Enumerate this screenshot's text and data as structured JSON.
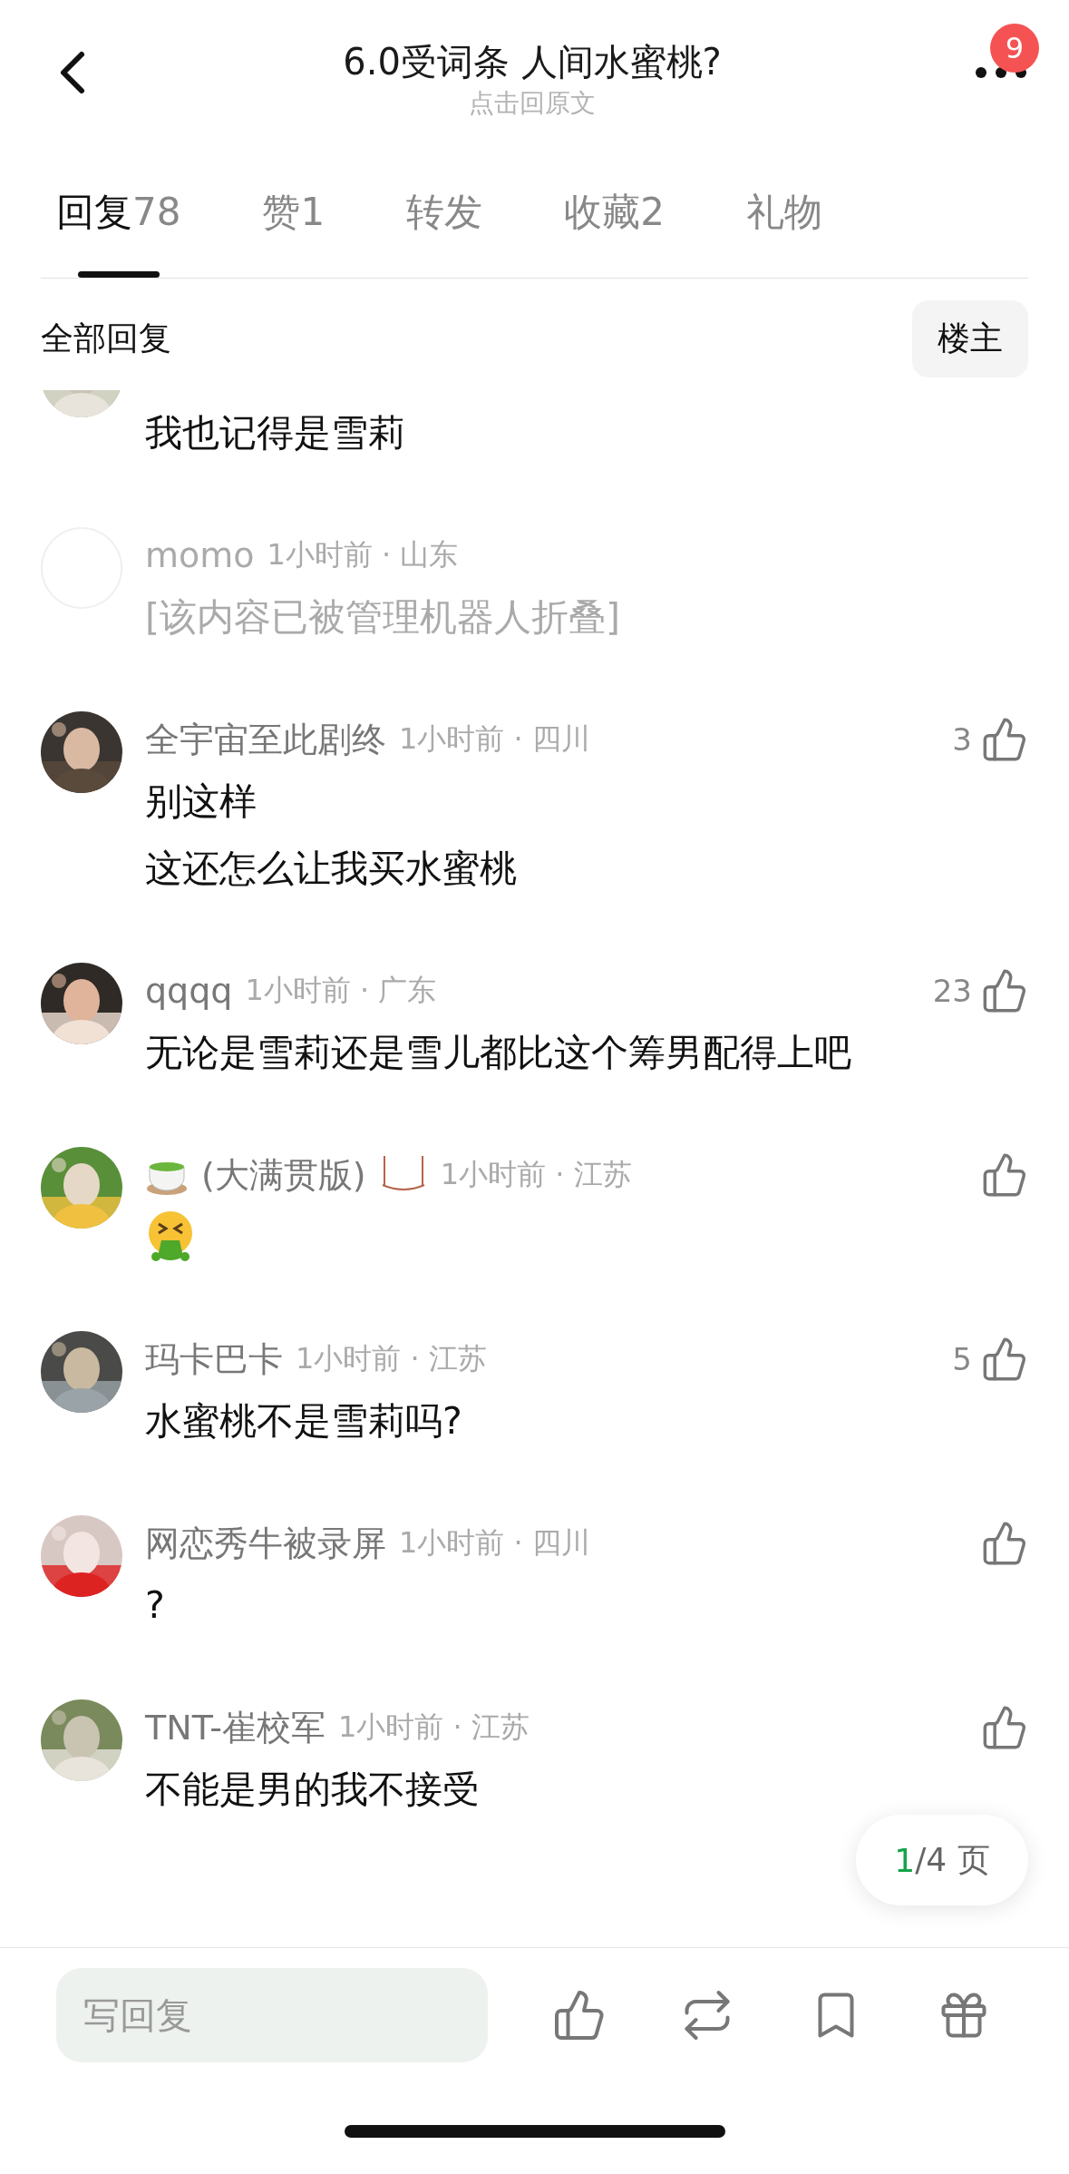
{
  "header": {
    "title": "6.0受词条 人间水蜜桃?",
    "subtitle": "点击回原文",
    "badge": "9"
  },
  "tabs": [
    {
      "label": "回复",
      "count": "78",
      "selected": true
    },
    {
      "label": "赞",
      "count": "1",
      "selected": false
    },
    {
      "label": "转发",
      "selected": false
    },
    {
      "label": "收藏",
      "count": "2",
      "selected": false
    },
    {
      "label": "礼物",
      "selected": false
    }
  ],
  "filter": {
    "title": "全部回复",
    "button": "楼主"
  },
  "comments": [
    {
      "kind": "partial",
      "lines": [
        "我也记得是雪莉"
      ]
    },
    {
      "kind": "folded",
      "name": "momo",
      "meta": "1小时前 · 山东",
      "lines": [
        "[该内容已被管理机器人折叠]"
      ]
    },
    {
      "kind": "text",
      "name": "全宇宙至此剧终",
      "meta": "1小时前 · 四川",
      "likes": "3",
      "lines": [
        "别这样",
        "这还怎么让我买水蜜桃"
      ]
    },
    {
      "kind": "text",
      "name": "qqqq",
      "meta": "1小时前 · 广东",
      "likes": "23",
      "lines": [
        "无论是雪莉还是雪儿都比这个筹男配得上吧"
      ]
    },
    {
      "kind": "emoji",
      "name": "(大满贯版)",
      "meta": "1小时前 · 江苏"
    },
    {
      "kind": "text",
      "name": "玛卡巴卡",
      "meta": "1小时前 · 江苏",
      "likes": "5",
      "lines": [
        "水蜜桃不是雪莉吗?"
      ]
    },
    {
      "kind": "text",
      "name": "网恋秀牛被录屏",
      "meta": "1小时前 · 四川",
      "lines": [
        "?"
      ]
    },
    {
      "kind": "text",
      "name": "TNT-崔校军",
      "meta": "1小时前 · 江苏",
      "lines": [
        "不能是男的我不接受"
      ]
    }
  ],
  "pager": {
    "current": "1",
    "total": "/4 页"
  },
  "reply_field": {
    "placeholder": "写回复"
  }
}
